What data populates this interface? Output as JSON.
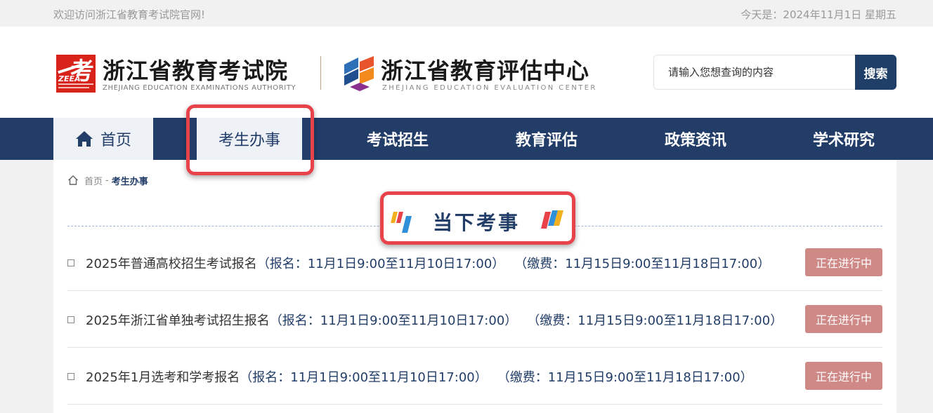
{
  "topbar": {
    "welcome": "欢迎访问浙江省教育考试院官网!",
    "date": "今天是：2024年11月1日 星期五"
  },
  "header": {
    "logo1": {
      "badge_char": "考",
      "badge_text": "ZEEA",
      "name": "浙江省教育考试院",
      "en": "ZHEJIANG EDUCATION EXAMINATIONS AUTHORITY"
    },
    "logo2": {
      "name": "浙江省教育评估中心",
      "en": "ZHEJIANG EDUCATION EVALUATION CENTER"
    },
    "search": {
      "placeholder": "请输入您想查询的内容",
      "button": "搜索"
    }
  },
  "nav": {
    "items": [
      {
        "label": "首页"
      },
      {
        "label": "考生办事"
      },
      {
        "label": "考试招生"
      },
      {
        "label": "教育评估"
      },
      {
        "label": "政策资讯"
      },
      {
        "label": "学术研究"
      }
    ]
  },
  "breadcrumb": {
    "home": "首页",
    "separator": "-",
    "current": "考生办事"
  },
  "section": {
    "title": "当下考事"
  },
  "rows": [
    {
      "title": "2025年普通高校招生考试报名",
      "registration": "（报名：11月1日9:00至11月10日17:00）",
      "payment": "（缴费：11月15日9:00至11月18日17:00）",
      "status": "正在进行中"
    },
    {
      "title": "2025年浙江省单独考试招生报名",
      "registration": "（报名：11月1日9:00至11月10日17:00）",
      "payment": "（缴费：11月15日9:00至11月18日17:00）",
      "status": "正在进行中"
    },
    {
      "title": "2025年1月选考和学考报名",
      "registration": "（报名：11月1日9:00至11月10日17:00）",
      "payment": "（缴费：11月15日9:00至11月18日17:00）",
      "status": "正在进行中"
    }
  ],
  "colors": {
    "nav_bg": "#213d68",
    "status_bg": "#cf8a87",
    "highlight": "#e8424b",
    "logo_red": "#d8231a"
  }
}
